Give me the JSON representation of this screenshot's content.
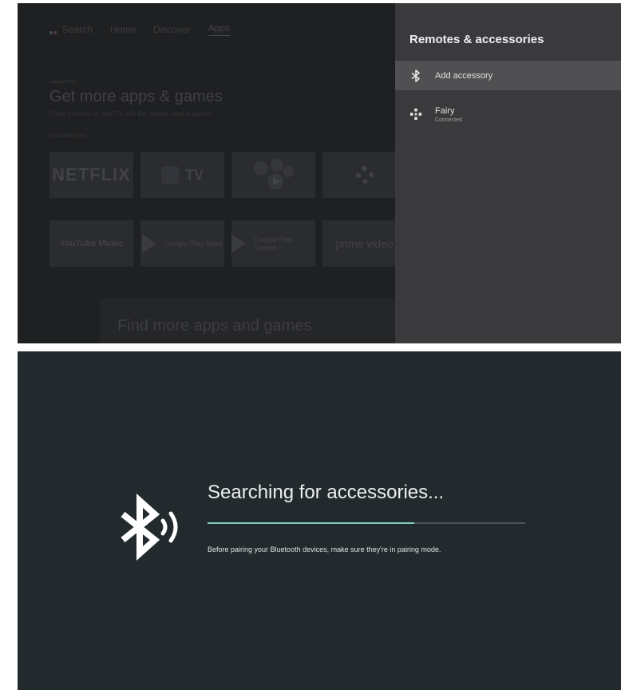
{
  "top_screen": {
    "home": {
      "nav": {
        "search": "Search",
        "home": "Home",
        "discover": "Discover",
        "apps": "Apps"
      },
      "brand": "Google Play",
      "heading": "Get more apps & games",
      "subheading": "Enjoy the most of your TV with the newest apps & games",
      "favorites_label": "Favorites Apps",
      "apps_row1": [
        "NETFLIX",
        "TV"
      ],
      "apps_row2": [
        "YouTube Music",
        "Google Play Store",
        "Google Play Games",
        "prime video"
      ],
      "find_more": "Find more apps and games"
    },
    "panel": {
      "title": "Remotes & accessories",
      "items": [
        {
          "label": "Add accessory",
          "icon": "bluetooth-icon"
        },
        {
          "label": "Fairy",
          "sublabel": "Connected",
          "icon": "gamepad-icon"
        }
      ]
    }
  },
  "bottom_screen": {
    "title": "Searching for accessories...",
    "hint": "Before pairing your Bluetooth devices, make sure they're in pairing mode.",
    "progress": 0.65,
    "icon": "bluetooth-searching-icon",
    "colors": {
      "background": "#232a2e",
      "progress": "#80cbc4"
    }
  }
}
